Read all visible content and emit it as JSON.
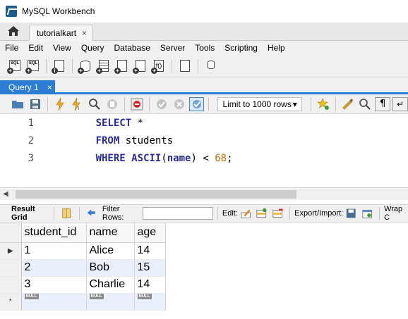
{
  "window": {
    "title": "MySQL Workbench"
  },
  "connection_tab": {
    "label": "tutorialkart",
    "close": "×"
  },
  "menu": [
    "File",
    "Edit",
    "View",
    "Query",
    "Database",
    "Server",
    "Tools",
    "Scripting",
    "Help"
  ],
  "query_tab": {
    "label": "Query 1",
    "close": "×"
  },
  "editor_toolbar": {
    "limit_label": "Limit to 1000 rows",
    "limit_arrow": "▾"
  },
  "editor": {
    "lines": [
      {
        "number": "1",
        "tokens": [
          {
            "t": "SELECT",
            "c": "kw"
          },
          {
            "t": " *",
            "c": "plain"
          }
        ]
      },
      {
        "number": "2",
        "tokens": [
          {
            "t": "FROM",
            "c": "kw"
          },
          {
            "t": " students",
            "c": "plain"
          }
        ]
      },
      {
        "number": "3",
        "tokens": [
          {
            "t": "WHERE",
            "c": "kw"
          },
          {
            "t": " ",
            "c": "plain"
          },
          {
            "t": "ASCII",
            "c": "kw"
          },
          {
            "t": "(",
            "c": "plain"
          },
          {
            "t": "name",
            "c": "kw"
          },
          {
            "t": ") < ",
            "c": "plain"
          },
          {
            "t": "68",
            "c": "num"
          },
          {
            "t": ";",
            "c": "plain"
          }
        ]
      }
    ]
  },
  "result_toolbar": {
    "result_grid": "Result Grid",
    "filter_rows": "Filter Rows:",
    "edit": "Edit:",
    "export_import": "Export/Import:",
    "wrap": "Wrap C"
  },
  "result_grid": {
    "columns": [
      "student_id",
      "name",
      "age"
    ],
    "rows": [
      [
        "1",
        "Alice",
        "14"
      ],
      [
        "2",
        "Bob",
        "15"
      ],
      [
        "3",
        "Charlie",
        "14"
      ]
    ],
    "null_label": "NULL",
    "current_row_marker": "▶",
    "new_row_marker": "*"
  }
}
